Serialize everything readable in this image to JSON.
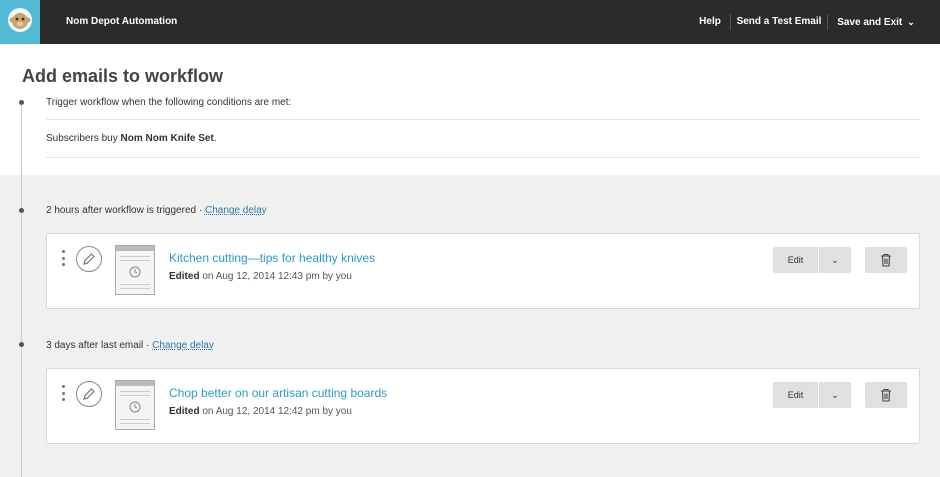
{
  "app": {
    "title": "Nom Depot Automation",
    "logo_icon": "monkey-logo-icon"
  },
  "nav": {
    "help": "Help",
    "send_test": "Send a Test Email",
    "save_exit": "Save and Exit",
    "save_exit_chevron": "⌄"
  },
  "page": {
    "title": "Add emails to workflow"
  },
  "trigger": {
    "heading": "Trigger workflow when the following conditions are met:",
    "condition_prefix": "Subscribers buy ",
    "condition_product": "Nom Nom Knife Set",
    "condition_suffix": "."
  },
  "steps": [
    {
      "delay": "2 hours after workflow is triggered",
      "delay_sep": " · ",
      "change_delay": "Change delay",
      "email": {
        "title": "Kitchen cutting—tips for healthy knives",
        "status": "Edited",
        "meta": " on Aug 12, 2014 12:43 pm by you",
        "edit_label": "Edit",
        "dropdown_label": "⌄"
      }
    },
    {
      "delay": "3 days after last email",
      "delay_sep": " · ",
      "change_delay": "Change delay",
      "email": {
        "title": "Chop better on our artisan cutting boards",
        "status": "Edited",
        "meta": " on Aug 12, 2014 12:42 pm by you",
        "edit_label": "Edit",
        "dropdown_label": "⌄"
      }
    }
  ],
  "colors": {
    "topbar": "#2b2b2b",
    "logo_bg": "#52bad5",
    "link": "#2a7da8",
    "email_title": "#2a9bc7",
    "grey_bg": "#f0f0f0"
  }
}
